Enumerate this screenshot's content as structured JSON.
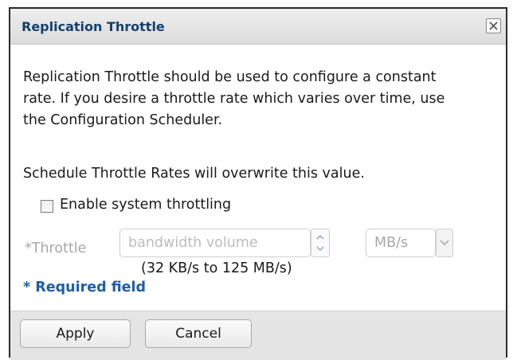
{
  "dialog": {
    "title": "Replication Throttle",
    "close_icon": "close-icon"
  },
  "content": {
    "description": "Replication Throttle should be used to configure a constant rate. If you desire a throttle rate which varies over time, use the Configuration Scheduler.",
    "warning": "Schedule Throttle Rates will overwrite this value.",
    "enable_label": "Enable system throttling",
    "enable_checked": false,
    "throttle_label": "*Throttle",
    "bandwidth_placeholder": "bandwidth volume",
    "bandwidth_value": "",
    "unit": "MB/s",
    "range_hint": "(32 KB/s to 125 MB/s)",
    "required_note": "* Required field"
  },
  "footer": {
    "apply_label": "Apply",
    "cancel_label": "Cancel"
  },
  "colors": {
    "title_text": "#15406e",
    "required_text": "#1d5ea8",
    "disabled_text": "#a8a8a8",
    "footer_bg": "#e5e5e5"
  }
}
